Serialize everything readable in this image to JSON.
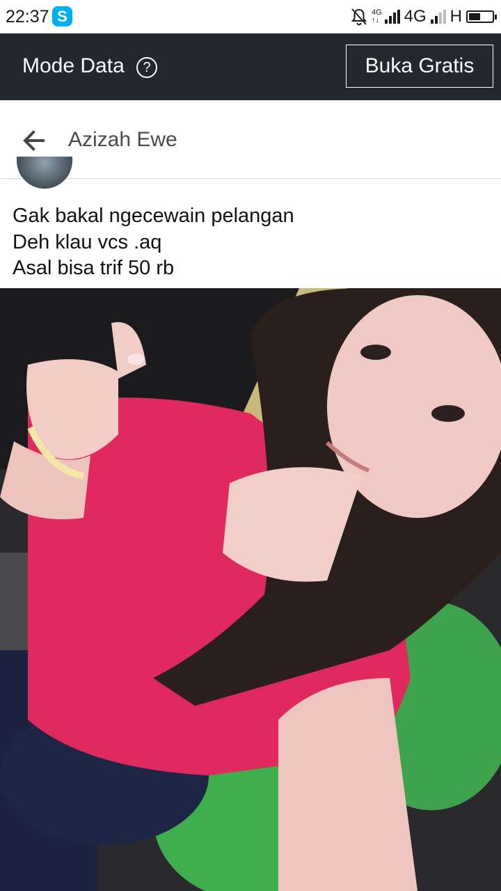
{
  "status_bar": {
    "time": "22:37",
    "app_icon": "skype-icon",
    "network_small_top": "4G",
    "network_small_bottom": "↑↓",
    "network_label": "4G",
    "network_h": "H",
    "battery_level": 0.5,
    "icons": [
      "bell-off-icon",
      "signal-icon",
      "battery-icon"
    ]
  },
  "mode_bar": {
    "title": "Mode Data",
    "help_icon": "question-circle-icon",
    "button_label": "Buka Gratis",
    "background": "#23272e"
  },
  "header": {
    "back_icon": "arrow-left-icon",
    "name": "Azizah Ewe"
  },
  "post": {
    "lines": [
      "Gak bakal ngecewain pelangan",
      "Deh klau vcs .aq",
      "Asal bisa trif 50 rb"
    ],
    "photo_icon": "photo-image"
  }
}
